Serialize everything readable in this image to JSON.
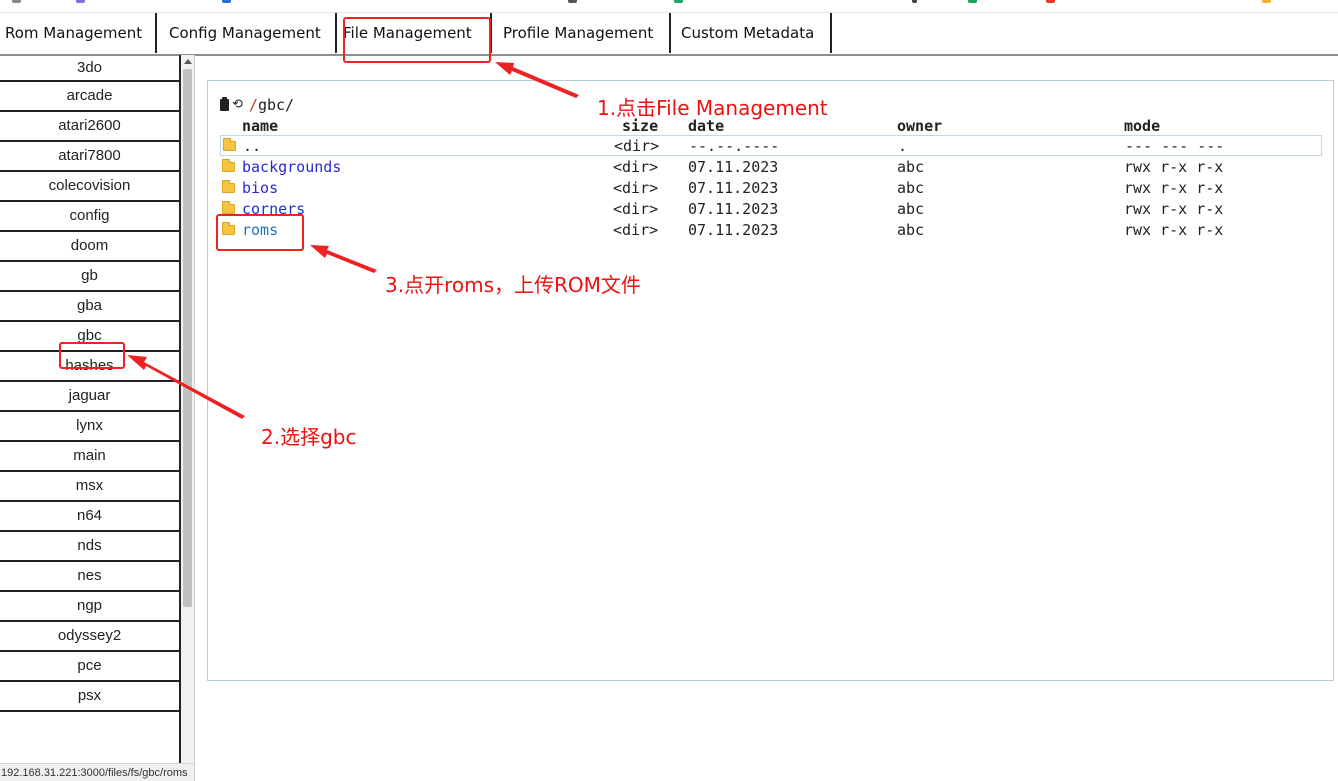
{
  "tabs": [
    {
      "label": "Rom Management"
    },
    {
      "label": "Config Management"
    },
    {
      "label": "File Management"
    },
    {
      "label": "Profile Management"
    },
    {
      "label": "Custom Metadata"
    }
  ],
  "sidebar": {
    "items": [
      {
        "label": "3do"
      },
      {
        "label": "arcade"
      },
      {
        "label": "atari2600"
      },
      {
        "label": "atari7800"
      },
      {
        "label": "colecovision"
      },
      {
        "label": "config"
      },
      {
        "label": "doom"
      },
      {
        "label": "gb"
      },
      {
        "label": "gba"
      },
      {
        "label": "gbc"
      },
      {
        "label": "hashes"
      },
      {
        "label": "jaguar"
      },
      {
        "label": "lynx"
      },
      {
        "label": "main"
      },
      {
        "label": "msx"
      },
      {
        "label": "n64"
      },
      {
        "label": "nds"
      },
      {
        "label": "nes"
      },
      {
        "label": "ngp"
      },
      {
        "label": "odyssey2"
      },
      {
        "label": "pce"
      },
      {
        "label": "psx"
      }
    ]
  },
  "filebrowser": {
    "path_sep1": "/",
    "path_name": "gbc",
    "path_sep2": "/",
    "headers": {
      "name": "name",
      "size": "size",
      "date": "date",
      "owner": "owner",
      "mode": "mode"
    },
    "rows": [
      {
        "name": "..",
        "size": "<dir>",
        "date": "--.--.----",
        "owner": ".",
        "mode": "--- --- ---"
      },
      {
        "name": "backgrounds",
        "size": "<dir>",
        "date": "07.11.2023",
        "owner": "abc",
        "mode": "rwx r-x r-x"
      },
      {
        "name": "bios",
        "size": "<dir>",
        "date": "07.11.2023",
        "owner": "abc",
        "mode": "rwx r-x r-x"
      },
      {
        "name": "corners",
        "size": "<dir>",
        "date": "07.11.2023",
        "owner": "abc",
        "mode": "rwx r-x r-x"
      },
      {
        "name": "roms",
        "size": "<dir>",
        "date": "07.11.2023",
        "owner": "abc",
        "mode": "rwx r-x r-x"
      }
    ]
  },
  "annotations": {
    "step1": "1.点击File Management",
    "step2": "2.选择gbc",
    "step3": "3.点开roms，上传ROM文件",
    "color": "#ee1111"
  },
  "statusbar": {
    "url": "192.168.31.221:3000/files/fs/gbc/roms"
  }
}
